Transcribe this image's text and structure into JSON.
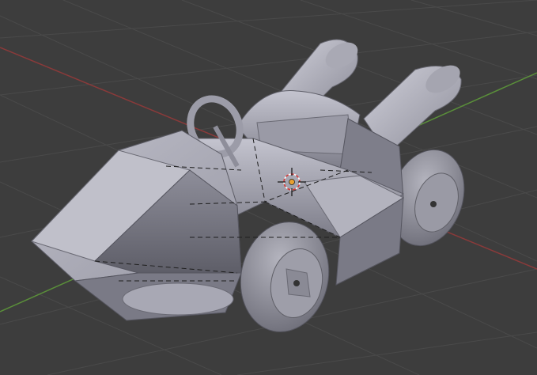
{
  "viewport": {
    "background": "#3d3d3d",
    "grid_color": "#4a4a4a",
    "x_axis_color": "#8a3a3a",
    "y_axis_color": "#5a8f3a"
  },
  "model": {
    "object": "kart",
    "body_color": "#8a8a96",
    "highlight_color": "#b9b9c4",
    "shadow_color": "#5c5c66",
    "edge_style": "dashed-wire-edges"
  },
  "cursor_3d": {
    "icon": "crosshair-3d-cursor-icon",
    "ring_colors": [
      "#ffffff",
      "#d23a3a"
    ]
  },
  "origin": {
    "icon": "object-origin-dot-icon",
    "color": "#e8a030"
  }
}
